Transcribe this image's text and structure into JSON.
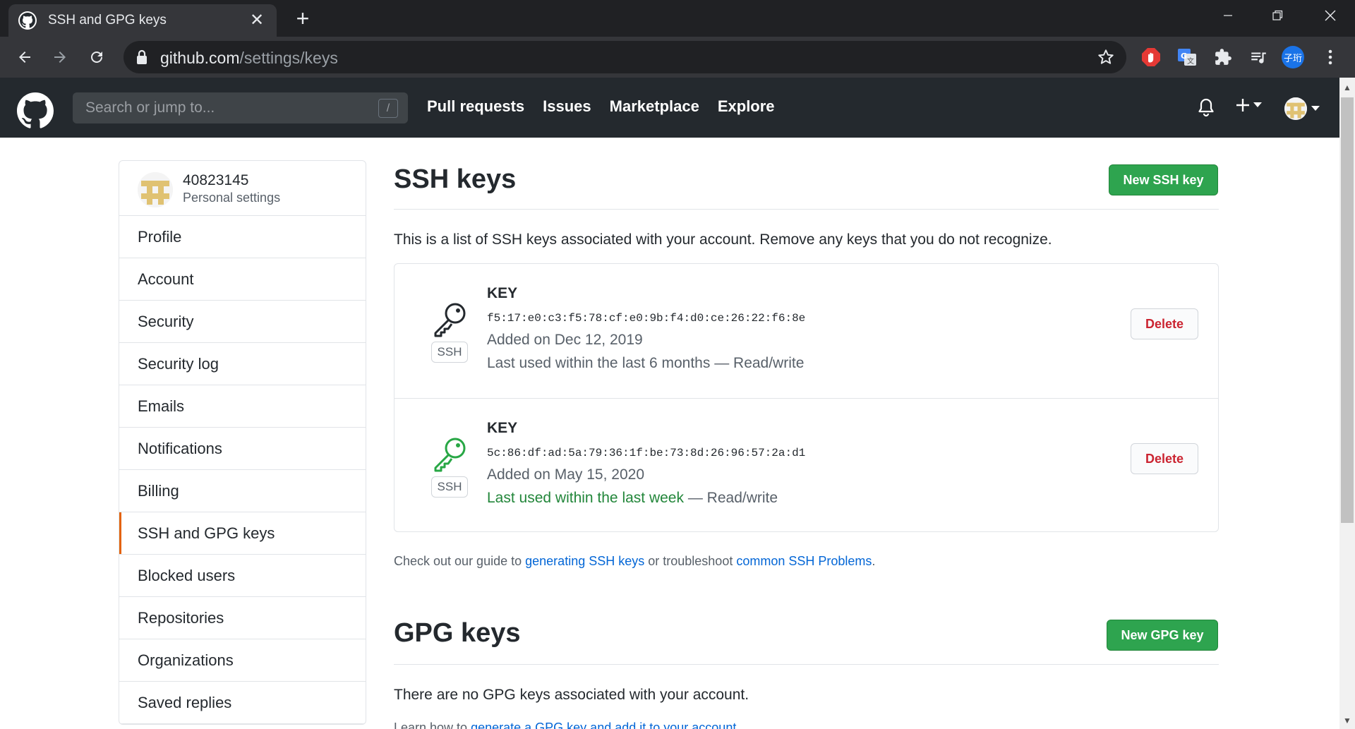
{
  "browser": {
    "tab_title": "SSH and GPG keys",
    "url_host": "github.com",
    "url_path": "/settings/keys",
    "extension_avatar_text": "子珩"
  },
  "header": {
    "search_placeholder": "Search or jump to...",
    "search_shortcut": "/",
    "nav": [
      "Pull requests",
      "Issues",
      "Marketplace",
      "Explore"
    ]
  },
  "sidebar": {
    "username": "40823145",
    "subtitle": "Personal settings",
    "items": [
      {
        "label": "Profile"
      },
      {
        "label": "Account"
      },
      {
        "label": "Security"
      },
      {
        "label": "Security log"
      },
      {
        "label": "Emails"
      },
      {
        "label": "Notifications"
      },
      {
        "label": "Billing"
      },
      {
        "label": "SSH and GPG keys",
        "active": true
      },
      {
        "label": "Blocked users"
      },
      {
        "label": "Repositories"
      },
      {
        "label": "Organizations"
      },
      {
        "label": "Saved replies"
      }
    ]
  },
  "ssh": {
    "title": "SSH keys",
    "new_button": "New SSH key",
    "description": "This is a list of SSH keys associated with your account. Remove any keys that you do not recognize.",
    "keys": [
      {
        "label": "KEY",
        "badge": "SSH",
        "fingerprint": "f5:17:e0:c3:f5:78:cf:e0:9b:f4:d0:ce:26:22:f6:8e",
        "added": "Added on Dec 12, 2019",
        "last_used": "Last used within the last 6 months",
        "access": "— Read/write",
        "icon_color": "#24292e",
        "delete_label": "Delete"
      },
      {
        "label": "KEY",
        "badge": "SSH",
        "fingerprint": "5c:86:df:ad:5a:79:36:1f:be:73:8d:26:96:57:2a:d1",
        "added": "Added on May 15, 2020",
        "last_used": "Last used within the last week",
        "access": "— Read/write",
        "icon_color": "#28a745",
        "delete_label": "Delete"
      }
    ],
    "help_prefix": "Check out our guide to",
    "help_link1": "generating SSH keys",
    "help_middle": "or troubleshoot",
    "help_link2": "common SSH Problems",
    "help_suffix": "."
  },
  "gpg": {
    "title": "GPG keys",
    "new_button": "New GPG key",
    "description": "There are no GPG keys associated with your account.",
    "learn_prefix": "Learn how to",
    "learn_link": "generate a GPG key and add it to your account",
    "learn_suffix": "."
  },
  "colors": {
    "accent_green": "#2ea44f",
    "active_marker": "#e36209",
    "link": "#0366d6",
    "danger": "#cb2431"
  }
}
